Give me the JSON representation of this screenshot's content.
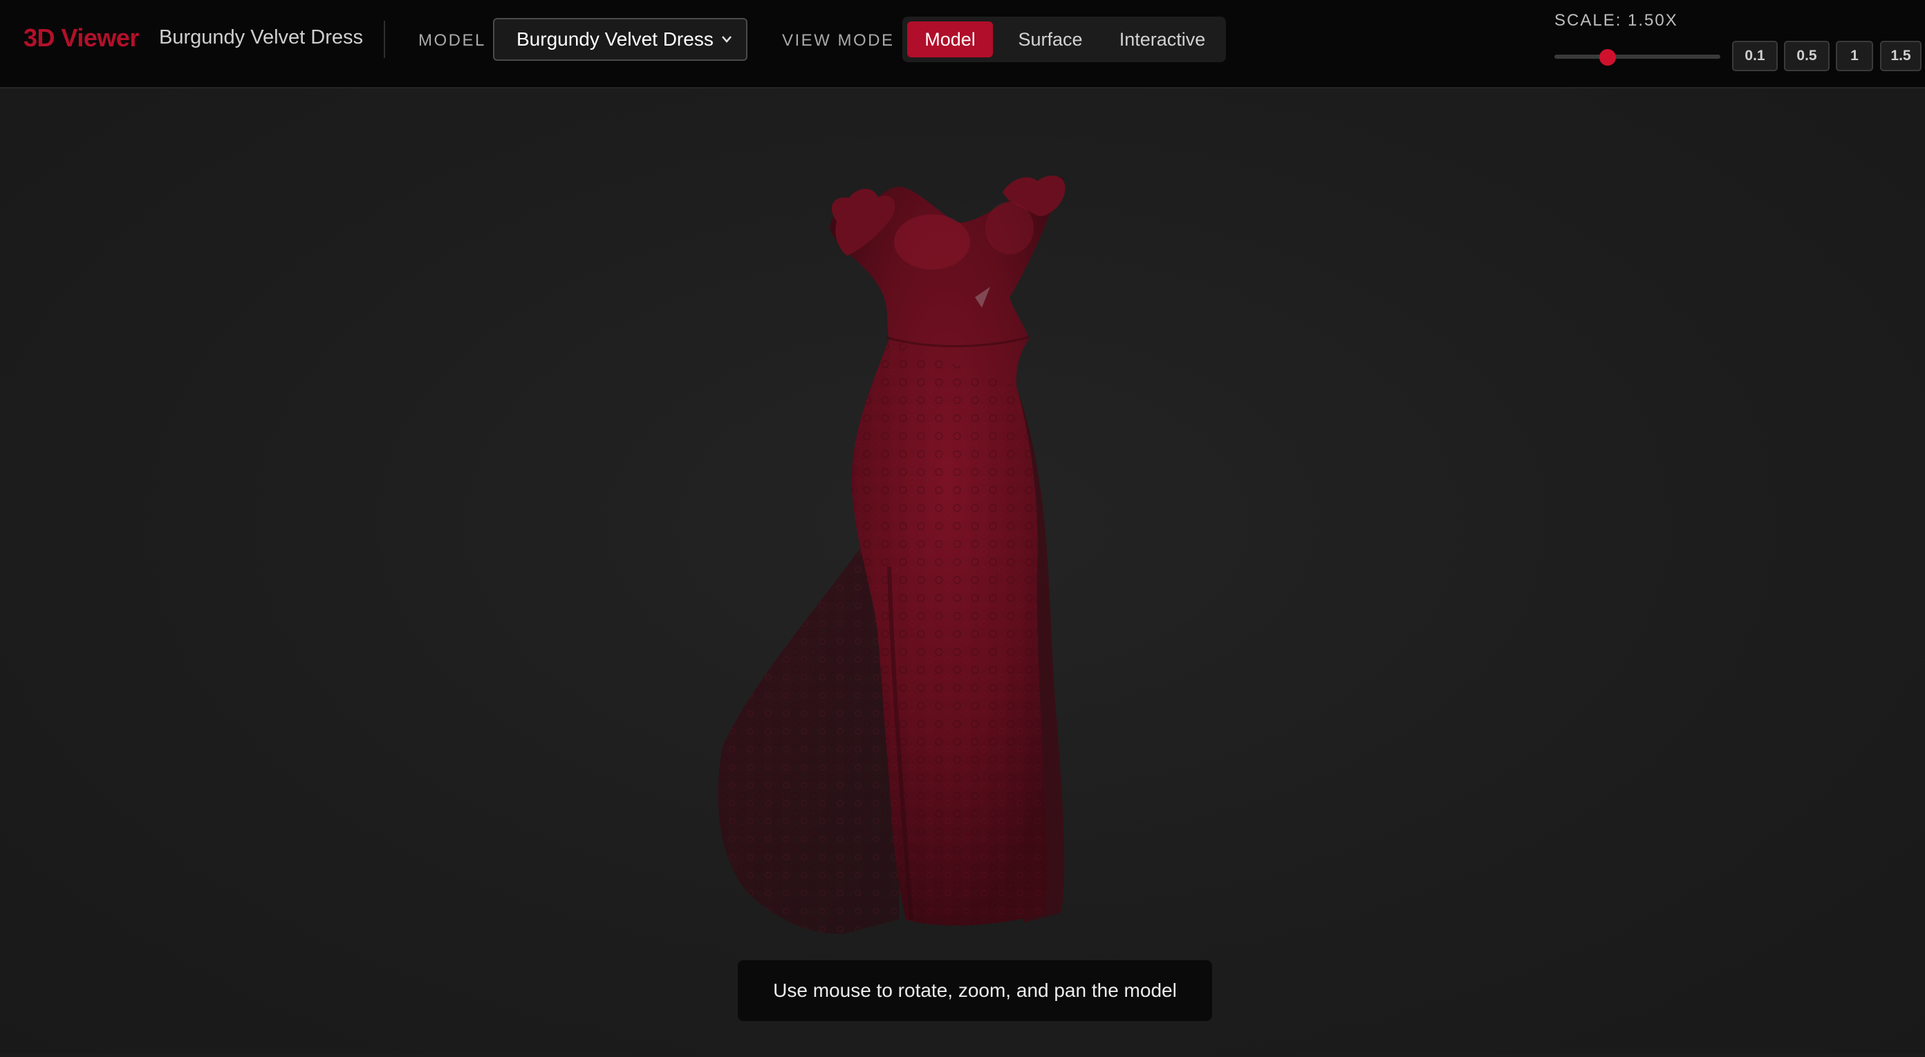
{
  "header": {
    "brand": "3D Viewer",
    "current_model": "Burgundy Velvet Dress",
    "model_label": "MODEL",
    "model_select_value": "Burgundy Velvet Dress",
    "view_mode_label": "VIEW MODE",
    "view_modes": [
      {
        "label": "Model",
        "active": true
      },
      {
        "label": "Surface",
        "active": false
      },
      {
        "label": "Interactive",
        "active": false
      }
    ]
  },
  "scale": {
    "label": "SCALE: 1.50X",
    "value": 1.5,
    "slider_fraction": 0.32,
    "presets": [
      "0.1",
      "0.5",
      "1",
      "1.5"
    ]
  },
  "viewport": {
    "hint": "Use mouse to rotate, zoom, and pan the model"
  },
  "colors": {
    "accent": "#b00e2a",
    "dress": "#6e0f1f",
    "background": "#1c1c1c"
  },
  "icons": {
    "select_chevron": "chevron-down-icon"
  }
}
